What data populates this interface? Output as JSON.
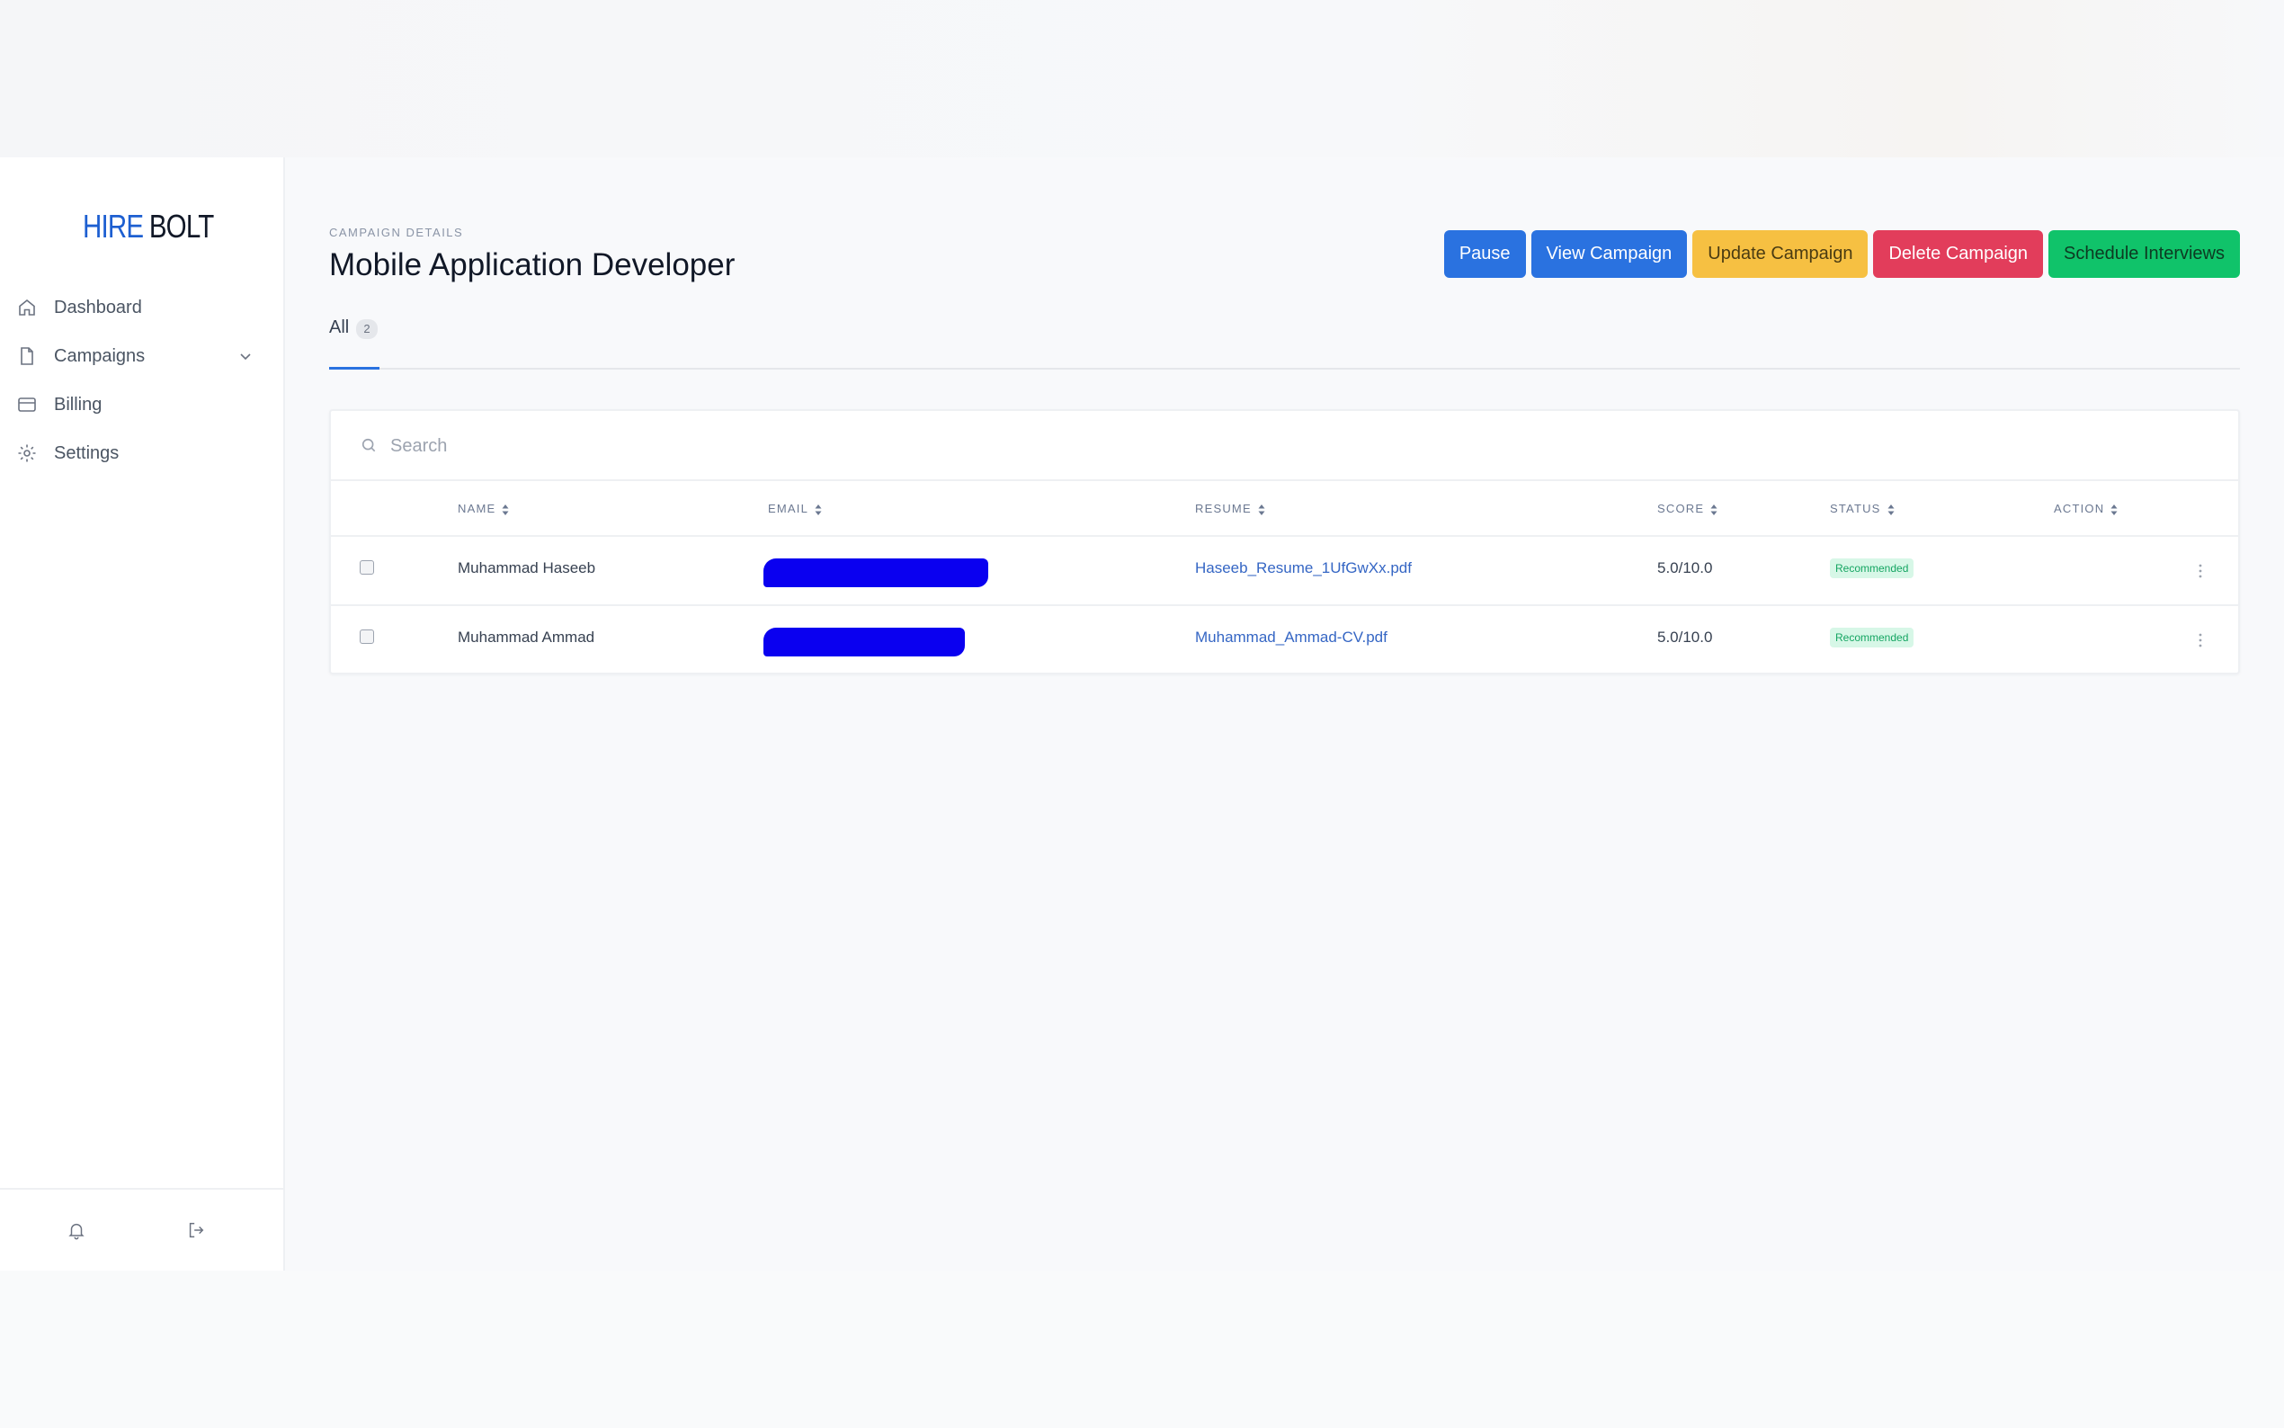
{
  "brand": {
    "hire": "HIRE",
    "bolt": "BOLT",
    "color": "#1d5fd1"
  },
  "sidebar": {
    "items": [
      {
        "label": "Dashboard",
        "icon": "home-icon"
      },
      {
        "label": "Campaigns",
        "icon": "file-icon",
        "expandable": true
      },
      {
        "label": "Billing",
        "icon": "credit-card-icon"
      },
      {
        "label": "Settings",
        "icon": "gear-icon"
      }
    ],
    "bottom_icons": [
      "bell-icon",
      "logout-icon"
    ]
  },
  "header": {
    "eyebrow": "CAMPAIGN DETAILS",
    "title": "Mobile Application Developer"
  },
  "actions": {
    "pause": "Pause",
    "view": "View Campaign",
    "update": "Update Campaign",
    "delete": "Delete Campaign",
    "schedule": "Schedule Interviews"
  },
  "tabs": [
    {
      "label": "All",
      "count": "2",
      "active": true
    }
  ],
  "search": {
    "placeholder": "Search",
    "value": ""
  },
  "table": {
    "columns": [
      "NAME",
      "EMAIL",
      "RESUME",
      "SCORE",
      "STATUS",
      "ACTION"
    ],
    "rows": [
      {
        "name": "Muhammad Haseeb",
        "email": "[redacted]",
        "resume": "Haseeb_Resume_1UfGwXx.pdf",
        "score": "5.0/10.0",
        "status": "Recommended"
      },
      {
        "name": "Muhammad Ammad",
        "email": "[redacted]",
        "resume": "Muhammad_Ammad-CV.pdf",
        "score": "5.0/10.0",
        "status": "Recommended"
      }
    ]
  },
  "colors": {
    "primary": "#2a72e0",
    "warning": "#f6c042",
    "danger": "#e23d5b",
    "success": "#10c36a",
    "redaction": "#0a00f0"
  }
}
